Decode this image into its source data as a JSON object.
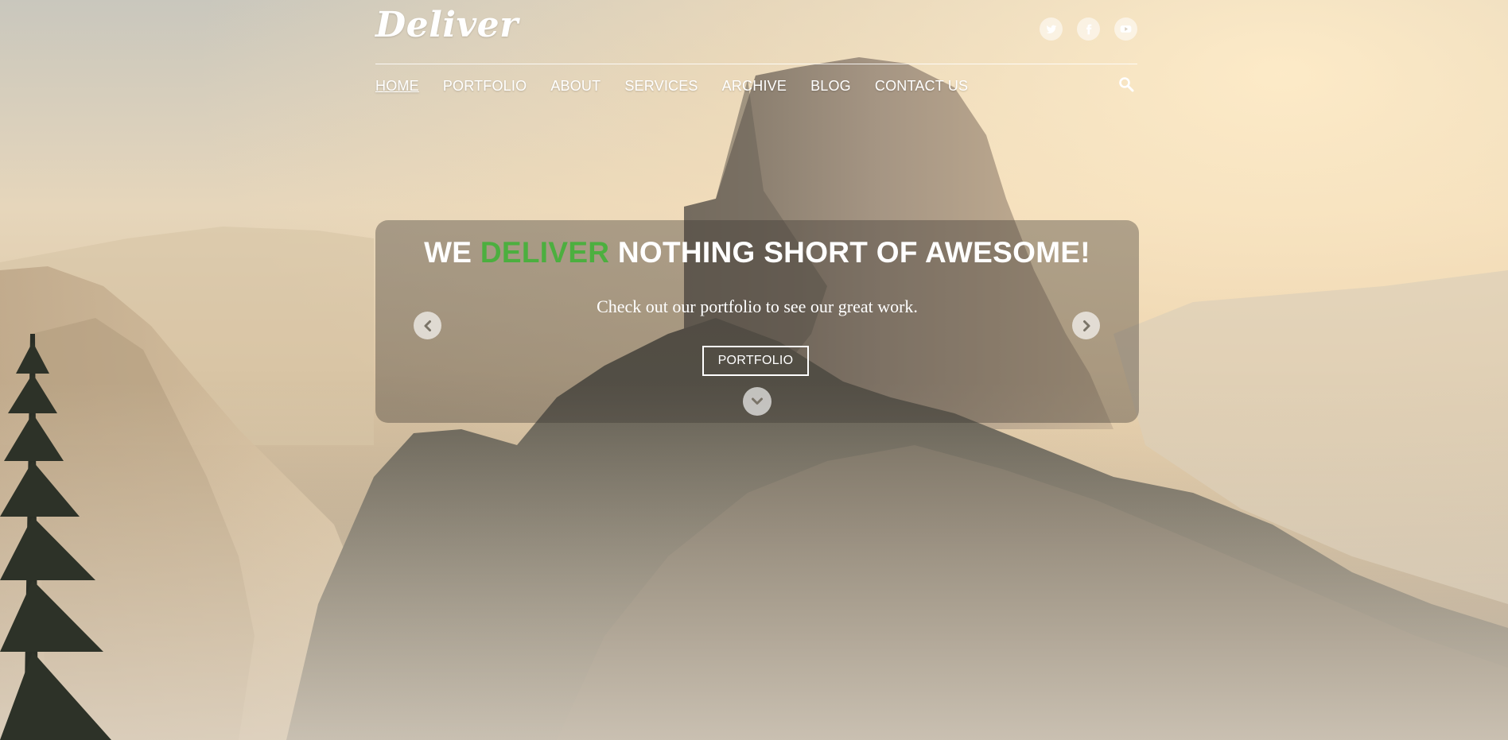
{
  "brand": {
    "logo_text": "Deliver"
  },
  "social": [
    {
      "name": "twitter-icon",
      "glyph": "t"
    },
    {
      "name": "facebook-icon",
      "glyph": "f"
    },
    {
      "name": "youtube-icon",
      "glyph": "▶"
    }
  ],
  "nav": {
    "items": [
      {
        "label": "HOME",
        "active": true
      },
      {
        "label": "PORTFOLIO",
        "active": false
      },
      {
        "label": "ABOUT",
        "active": false
      },
      {
        "label": "SERVICES",
        "active": false
      },
      {
        "label": "ARCHIVE",
        "active": false
      },
      {
        "label": "BLOG",
        "active": false
      },
      {
        "label": "CONTACT US",
        "active": false
      }
    ],
    "search_icon": "search-icon"
  },
  "hero": {
    "headline_pre": "WE ",
    "headline_accent": "DELIVER",
    "headline_post": " NOTHING SHORT OF AWESOME!",
    "subline": "Check out our portfolio to see our great work.",
    "button_label": "PORTFOLIO",
    "accent_color": "#4caf3f",
    "prev_icon": "chevron-left-icon",
    "next_icon": "chevron-right-icon",
    "scroll_icon": "chevron-down-icon"
  }
}
